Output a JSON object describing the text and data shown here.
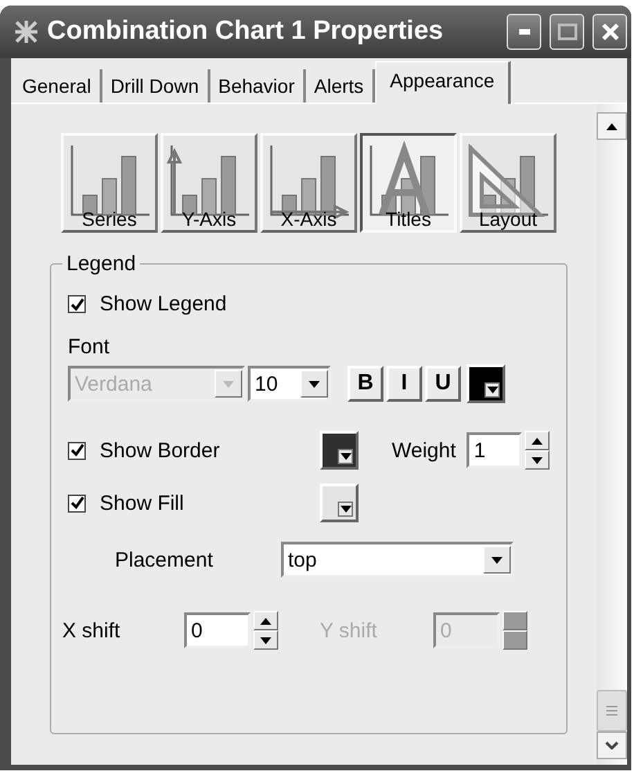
{
  "window": {
    "title": "Combination Chart 1 Properties"
  },
  "tabs": [
    {
      "label": "General",
      "selected": false
    },
    {
      "label": "Drill Down",
      "selected": false
    },
    {
      "label": "Behavior",
      "selected": false
    },
    {
      "label": "Alerts",
      "selected": false
    },
    {
      "label": "Appearance",
      "selected": true
    }
  ],
  "chart_tabs": [
    {
      "label": "Series",
      "kind": "series",
      "selected": false
    },
    {
      "label": "Y-Axis",
      "kind": "y_axis",
      "selected": false
    },
    {
      "label": "X-Axis",
      "kind": "x_axis",
      "selected": false
    },
    {
      "label": "Titles",
      "kind": "titles",
      "selected": true
    },
    {
      "label": "Layout",
      "kind": "layout",
      "selected": false
    }
  ],
  "legend": {
    "title": "Legend",
    "show_legend": {
      "label": "Show Legend",
      "checked": true
    },
    "font": {
      "label": "Font",
      "family": "Verdana",
      "family_disabled": true,
      "size": "10",
      "styles": [
        {
          "label": "B",
          "selected": false
        },
        {
          "label": "I",
          "selected": false
        },
        {
          "label": "U",
          "selected": false
        }
      ],
      "color": "#000000"
    },
    "show_border": {
      "label": "Show Border",
      "checked": true,
      "color": "#303030"
    },
    "weight": {
      "label": "Weight",
      "value": "1"
    },
    "show_fill": {
      "label": "Show Fill",
      "checked": true,
      "color": "#e4e4e4"
    },
    "placement": {
      "label": "Placement",
      "value": "top"
    },
    "x_shift": {
      "label": "X shift",
      "value": "0",
      "disabled": false
    },
    "y_shift": {
      "label": "Y shift",
      "value": "0",
      "disabled": true
    }
  }
}
